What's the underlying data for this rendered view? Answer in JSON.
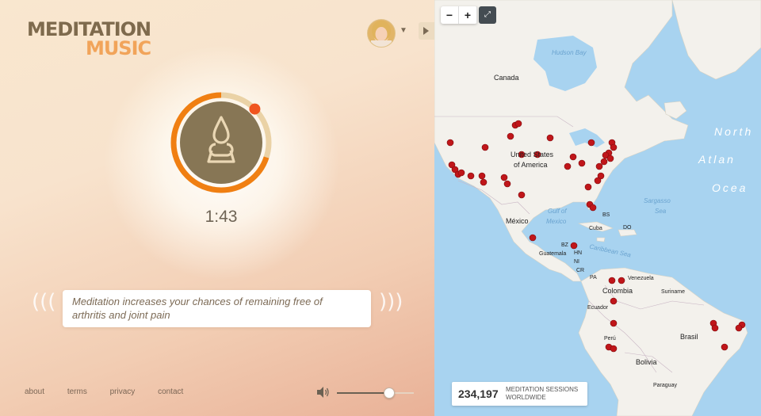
{
  "app": {
    "logo_line1": "MEDITATION",
    "logo_line2": "MUSIC"
  },
  "session": {
    "timer": "1:43",
    "progress_fraction": 0.7
  },
  "fact": {
    "text": "Meditation increases your chances of remaining free of arthritis and joint pain"
  },
  "footer": {
    "links": [
      "about",
      "terms",
      "privacy",
      "contact"
    ]
  },
  "volume": {
    "level_fraction": 0.67
  },
  "map": {
    "zoom_in": "+",
    "zoom_out": "−",
    "labels": {
      "canada": "Canada",
      "usa_line1": "United States",
      "usa_line2": "of America",
      "mexico": "México",
      "cuba": "Cuba",
      "bs": "BS",
      "do": "DO",
      "guatemala": "Guatemala",
      "bz": "BZ",
      "hn": "HN",
      "ni": "NI",
      "cr": "CR",
      "pa": "PA",
      "venezuela": "Venezuela",
      "colombia": "Colombia",
      "suriname": "Suriname",
      "ecuador": "Ecuador",
      "peru": "Perú",
      "brasil": "Brasil",
      "bolivia": "Bolivia",
      "paraguay": "Paraguay",
      "hudson_bay": "Hudson Bay",
      "gulf_line1": "Gulf of",
      "gulf_line2": "Mexico",
      "sargasso_line1": "Sargasso",
      "sargasso_line2": "Sea",
      "caribbean": "Caribbean Sea",
      "north": "North",
      "atlantic": "Atlan",
      "ocean": "Ocea"
    },
    "sessions_count": "234,197",
    "sessions_label_line1": "MEDITATION SESSIONS",
    "sessions_label_line2": "WORLDWIDE"
  },
  "colors": {
    "accent_orange": "#f07f12",
    "ring_track": "#e9cf9f",
    "pin_red": "#c0161a",
    "land": "#f3f1ec",
    "water": "#a8d3f0"
  }
}
